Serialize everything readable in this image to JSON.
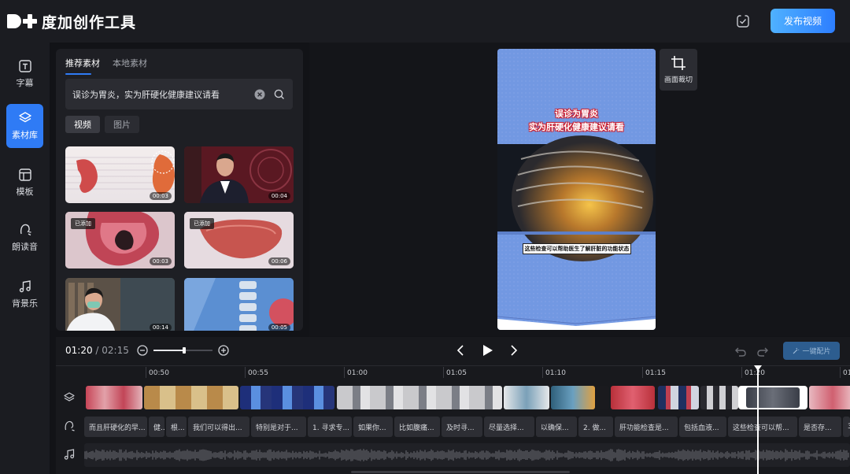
{
  "app": {
    "name": "度加创作工具",
    "publish_label": "发布视频"
  },
  "nav": [
    {
      "label": "字幕",
      "icon": "subtitle-icon"
    },
    {
      "label": "素材库",
      "icon": "layers-icon",
      "active": true
    },
    {
      "label": "模板",
      "icon": "template-icon"
    },
    {
      "label": "朗读音",
      "icon": "voice-icon"
    },
    {
      "label": "背景乐",
      "icon": "music-icon"
    }
  ],
  "library": {
    "tabs": [
      "推荐素材",
      "本地素材"
    ],
    "search_value": "误诊为胃炎，实为肝硬化健康建议请看",
    "filters": [
      "视频",
      "图片"
    ],
    "added_label": "已添加",
    "thumbs": [
      {
        "duration": "00:03"
      },
      {
        "duration": "00:04"
      },
      {
        "duration": "00:03",
        "added": true
      },
      {
        "duration": "00:06",
        "added": true
      },
      {
        "duration": "00:14"
      },
      {
        "duration": "00:05"
      }
    ]
  },
  "preview": {
    "caption_line1": "误诊为胃炎",
    "caption_line2": "实为肝硬化健康建议请看",
    "subtitle": "这些检查可以帮助医生了解肝脏的功能状态",
    "crop_label": "画面裁切"
  },
  "timeline": {
    "current": "01:20",
    "total": "/ 02:15",
    "onekey_label": "一键配片",
    "ticks": [
      "00:50",
      "00:55",
      "01:00",
      "01:05",
      "01:10",
      "01:15",
      "01:20",
      "01"
    ],
    "subtitles": [
      "而且肝硬化的早...",
      "健...",
      "根...",
      "我们可以得出...",
      "特别是对于...",
      "1. 寻求专...",
      "如果你...",
      "比如腹痛...",
      "及时寻...",
      "尽量选择...",
      "以确保...",
      "2. 做...",
      "肝功能检查是...",
      "包括血液...",
      "这些检查可以帮...",
      "是否存...",
      "3"
    ]
  },
  "colors": {
    "accent": "#2f7bf5",
    "publish_from": "#4fb1ff",
    "publish_to": "#2d7eff"
  }
}
